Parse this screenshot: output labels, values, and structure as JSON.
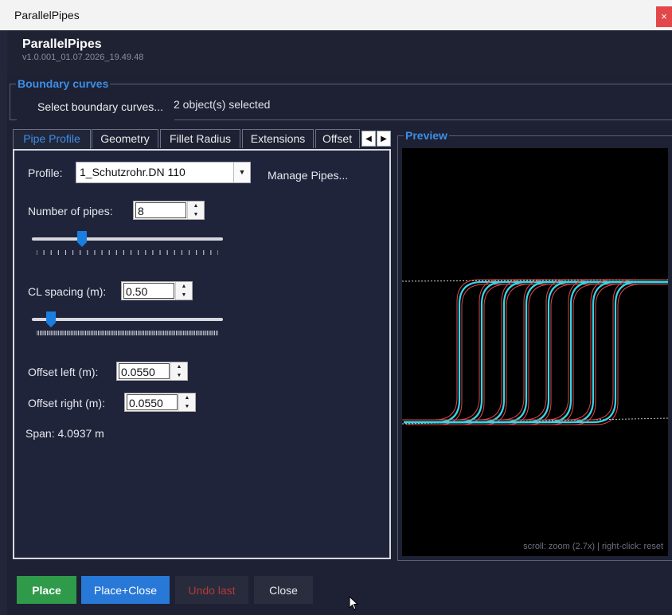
{
  "window": {
    "title": "ParallelPipes",
    "close_glyph": "×"
  },
  "header": {
    "app_name": "ParallelPipes",
    "version": "v1.0.001_01.07.2026_19.49.48"
  },
  "boundary": {
    "legend": "Boundary curves",
    "select_label": "Select boundary curves...",
    "selected_text": "2 object(s) selected"
  },
  "tabs": [
    {
      "label": "Pipe Profile",
      "active": true
    },
    {
      "label": "Geometry"
    },
    {
      "label": "Fillet Radius"
    },
    {
      "label": "Extensions"
    },
    {
      "label": "Offset L"
    }
  ],
  "tab_scroll": {
    "left": "◀",
    "right": "▶"
  },
  "pipe_profile": {
    "profile_label": "Profile:",
    "profile_value": "1_Schutzrohr.DN 110",
    "manage_label": "Manage Pipes...",
    "num_pipes_label": "Number of pipes:",
    "num_pipes_value": "8",
    "num_pipes_slider": 0.25,
    "cl_spacing_label": "CL spacing (m):",
    "cl_spacing_value": "0.50",
    "cl_spacing_slider": 0.08,
    "offset_left_label": "Offset left (m):",
    "offset_left_value": "0.0550",
    "offset_right_label": "Offset right (m):",
    "offset_right_value": "0.0550",
    "span_text": "Span: 4.0937 m"
  },
  "preview": {
    "legend": "Preview",
    "hint": "scroll: zoom (2.7x)  |  right-click: reset",
    "colors": {
      "pipe": "#35d6e6",
      "offset": "#e0484b",
      "boundary": "#cccccc"
    },
    "pipe_count": 8
  },
  "buttons": {
    "place": "Place",
    "place_close": "Place+Close",
    "undo": "Undo last",
    "close": "Close"
  }
}
